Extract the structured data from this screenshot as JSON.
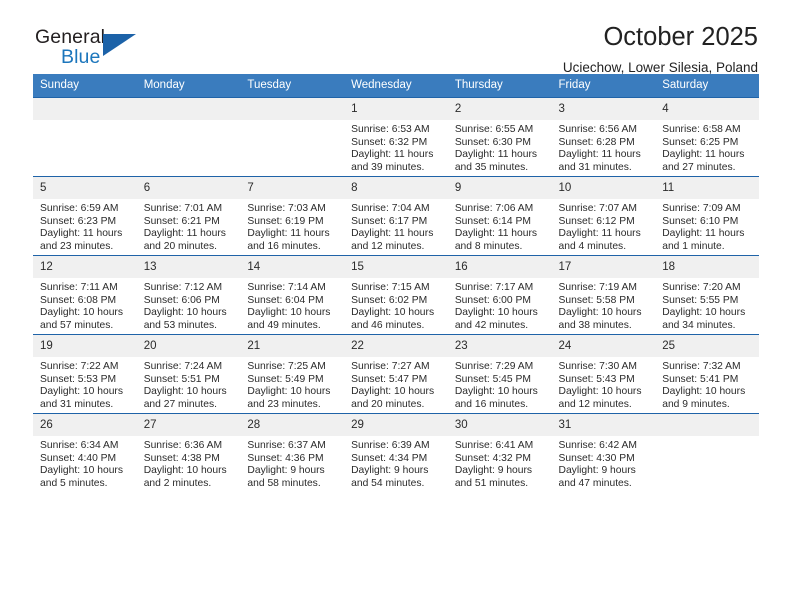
{
  "brand": {
    "name_part1": "General",
    "name_part2": "Blue",
    "triangle_icon": "triangle-icon"
  },
  "header": {
    "title": "October 2025",
    "subtitle": "Uciechow, Lower Silesia, Poland"
  },
  "colors": {
    "header_blue": "#3a7cbe",
    "rule_blue": "#1f63a8",
    "brand_blue": "#1c76bc",
    "daynum_band": "#f0f0f0"
  },
  "weekdays": [
    "Sunday",
    "Monday",
    "Tuesday",
    "Wednesday",
    "Thursday",
    "Friday",
    "Saturday"
  ],
  "weeks": [
    [
      {
        "day": "",
        "lines": []
      },
      {
        "day": "",
        "lines": []
      },
      {
        "day": "",
        "lines": []
      },
      {
        "day": "1",
        "lines": [
          "Sunrise: 6:53 AM",
          "Sunset: 6:32 PM",
          "Daylight: 11 hours",
          "and 39 minutes."
        ]
      },
      {
        "day": "2",
        "lines": [
          "Sunrise: 6:55 AM",
          "Sunset: 6:30 PM",
          "Daylight: 11 hours",
          "and 35 minutes."
        ]
      },
      {
        "day": "3",
        "lines": [
          "Sunrise: 6:56 AM",
          "Sunset: 6:28 PM",
          "Daylight: 11 hours",
          "and 31 minutes."
        ]
      },
      {
        "day": "4",
        "lines": [
          "Sunrise: 6:58 AM",
          "Sunset: 6:25 PM",
          "Daylight: 11 hours",
          "and 27 minutes."
        ]
      }
    ],
    [
      {
        "day": "5",
        "lines": [
          "Sunrise: 6:59 AM",
          "Sunset: 6:23 PM",
          "Daylight: 11 hours",
          "and 23 minutes."
        ]
      },
      {
        "day": "6",
        "lines": [
          "Sunrise: 7:01 AM",
          "Sunset: 6:21 PM",
          "Daylight: 11 hours",
          "and 20 minutes."
        ]
      },
      {
        "day": "7",
        "lines": [
          "Sunrise: 7:03 AM",
          "Sunset: 6:19 PM",
          "Daylight: 11 hours",
          "and 16 minutes."
        ]
      },
      {
        "day": "8",
        "lines": [
          "Sunrise: 7:04 AM",
          "Sunset: 6:17 PM",
          "Daylight: 11 hours",
          "and 12 minutes."
        ]
      },
      {
        "day": "9",
        "lines": [
          "Sunrise: 7:06 AM",
          "Sunset: 6:14 PM",
          "Daylight: 11 hours",
          "and 8 minutes."
        ]
      },
      {
        "day": "10",
        "lines": [
          "Sunrise: 7:07 AM",
          "Sunset: 6:12 PM",
          "Daylight: 11 hours",
          "and 4 minutes."
        ]
      },
      {
        "day": "11",
        "lines": [
          "Sunrise: 7:09 AM",
          "Sunset: 6:10 PM",
          "Daylight: 11 hours",
          "and 1 minute."
        ]
      }
    ],
    [
      {
        "day": "12",
        "lines": [
          "Sunrise: 7:11 AM",
          "Sunset: 6:08 PM",
          "Daylight: 10 hours",
          "and 57 minutes."
        ]
      },
      {
        "day": "13",
        "lines": [
          "Sunrise: 7:12 AM",
          "Sunset: 6:06 PM",
          "Daylight: 10 hours",
          "and 53 minutes."
        ]
      },
      {
        "day": "14",
        "lines": [
          "Sunrise: 7:14 AM",
          "Sunset: 6:04 PM",
          "Daylight: 10 hours",
          "and 49 minutes."
        ]
      },
      {
        "day": "15",
        "lines": [
          "Sunrise: 7:15 AM",
          "Sunset: 6:02 PM",
          "Daylight: 10 hours",
          "and 46 minutes."
        ]
      },
      {
        "day": "16",
        "lines": [
          "Sunrise: 7:17 AM",
          "Sunset: 6:00 PM",
          "Daylight: 10 hours",
          "and 42 minutes."
        ]
      },
      {
        "day": "17",
        "lines": [
          "Sunrise: 7:19 AM",
          "Sunset: 5:58 PM",
          "Daylight: 10 hours",
          "and 38 minutes."
        ]
      },
      {
        "day": "18",
        "lines": [
          "Sunrise: 7:20 AM",
          "Sunset: 5:55 PM",
          "Daylight: 10 hours",
          "and 34 minutes."
        ]
      }
    ],
    [
      {
        "day": "19",
        "lines": [
          "Sunrise: 7:22 AM",
          "Sunset: 5:53 PM",
          "Daylight: 10 hours",
          "and 31 minutes."
        ]
      },
      {
        "day": "20",
        "lines": [
          "Sunrise: 7:24 AM",
          "Sunset: 5:51 PM",
          "Daylight: 10 hours",
          "and 27 minutes."
        ]
      },
      {
        "day": "21",
        "lines": [
          "Sunrise: 7:25 AM",
          "Sunset: 5:49 PM",
          "Daylight: 10 hours",
          "and 23 minutes."
        ]
      },
      {
        "day": "22",
        "lines": [
          "Sunrise: 7:27 AM",
          "Sunset: 5:47 PM",
          "Daylight: 10 hours",
          "and 20 minutes."
        ]
      },
      {
        "day": "23",
        "lines": [
          "Sunrise: 7:29 AM",
          "Sunset: 5:45 PM",
          "Daylight: 10 hours",
          "and 16 minutes."
        ]
      },
      {
        "day": "24",
        "lines": [
          "Sunrise: 7:30 AM",
          "Sunset: 5:43 PM",
          "Daylight: 10 hours",
          "and 12 minutes."
        ]
      },
      {
        "day": "25",
        "lines": [
          "Sunrise: 7:32 AM",
          "Sunset: 5:41 PM",
          "Daylight: 10 hours",
          "and 9 minutes."
        ]
      }
    ],
    [
      {
        "day": "26",
        "lines": [
          "Sunrise: 6:34 AM",
          "Sunset: 4:40 PM",
          "Daylight: 10 hours",
          "and 5 minutes."
        ]
      },
      {
        "day": "27",
        "lines": [
          "Sunrise: 6:36 AM",
          "Sunset: 4:38 PM",
          "Daylight: 10 hours",
          "and 2 minutes."
        ]
      },
      {
        "day": "28",
        "lines": [
          "Sunrise: 6:37 AM",
          "Sunset: 4:36 PM",
          "Daylight: 9 hours",
          "and 58 minutes."
        ]
      },
      {
        "day": "29",
        "lines": [
          "Sunrise: 6:39 AM",
          "Sunset: 4:34 PM",
          "Daylight: 9 hours",
          "and 54 minutes."
        ]
      },
      {
        "day": "30",
        "lines": [
          "Sunrise: 6:41 AM",
          "Sunset: 4:32 PM",
          "Daylight: 9 hours",
          "and 51 minutes."
        ]
      },
      {
        "day": "31",
        "lines": [
          "Sunrise: 6:42 AM",
          "Sunset: 4:30 PM",
          "Daylight: 9 hours",
          "and 47 minutes."
        ]
      },
      {
        "day": "",
        "lines": []
      }
    ]
  ]
}
